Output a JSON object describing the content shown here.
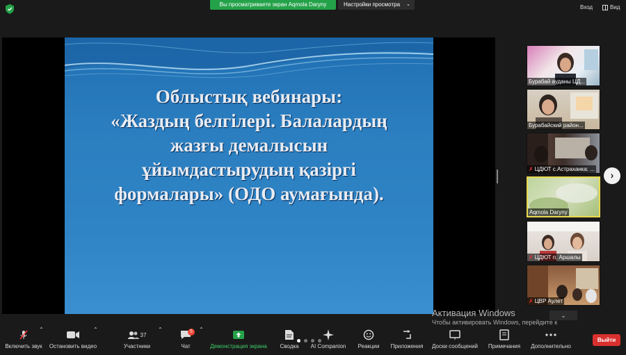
{
  "topbar": {
    "share_banner": "Вы просматриваете экран Aqmola Daryny",
    "view_settings": "Настройки просмотра",
    "enter": "Вход",
    "view": "Вид"
  },
  "slide": {
    "lines": [
      "Облыстық вебинары:",
      "«Жаздың белгілері. Балалардың",
      "жазғы демалысын",
      "ұйымдастырудың қазіргі",
      "формалары» (ОДО аумағында)."
    ]
  },
  "participants": [
    {
      "name": "Бурабай ауданы ЦД...",
      "muted": false
    },
    {
      "name": "Бурабайский район...",
      "muted": false
    },
    {
      "name": "ЦДЮТ с.Астраханка: ...",
      "muted": true
    },
    {
      "name": "Aqmola Daryny",
      "muted": false
    },
    {
      "name": "ЦДЮТ п. Аршалы",
      "muted": true
    },
    {
      "name": "ЦВР Аулет",
      "muted": true
    }
  ],
  "activation": {
    "title": "Активация Windows",
    "subtitle": "Чтобы активировать Windows, перейдите к параметрам компьютера."
  },
  "toolbar": {
    "unmute": "Включить звук",
    "stop_video": "Остановить видео",
    "participants": "Участники",
    "participants_count": "37",
    "chat": "Чат",
    "chat_badge": "5",
    "share_screen": "Демонстрация экрана",
    "summary": "Сводка",
    "ai_companion": "AI Companion",
    "reactions": "Реакции",
    "apps": "Приложения",
    "whiteboards": "Доски сообщений",
    "notes": "Примечания",
    "more": "Дополнительно",
    "exit": "Выйти"
  },
  "colors": {
    "share_green": "#24a249",
    "exit_red": "#d9302e",
    "active_border": "#e9d94e"
  }
}
